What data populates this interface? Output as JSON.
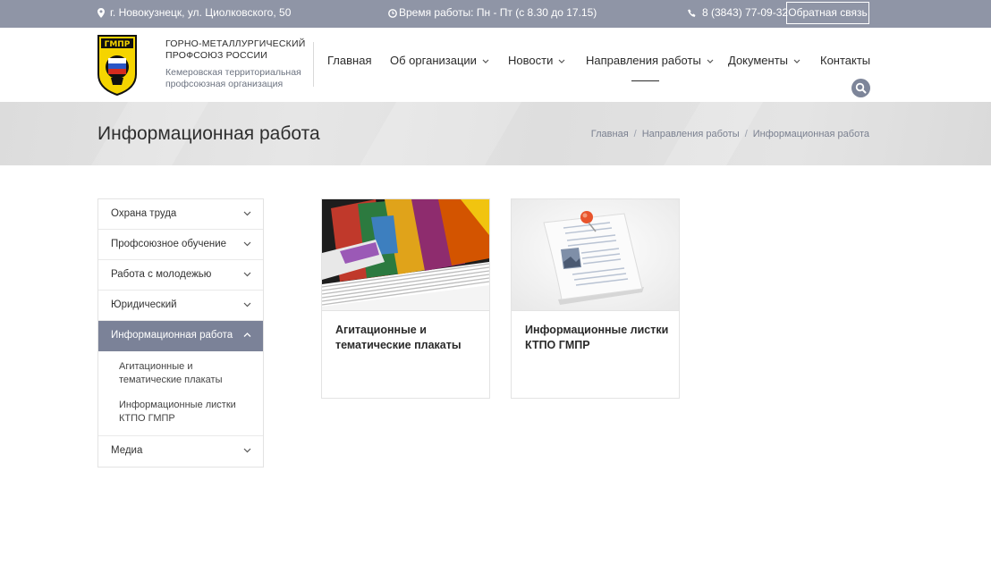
{
  "topbar": {
    "address": "г. Новокузнецк, ул. Циолковского, 50",
    "hours": "Время работы: Пн - Пт (с 8.30 до 17.15)",
    "phone": "8 (3843) 77-09-32",
    "feedback_label": "Обратная связь"
  },
  "brand": {
    "logo_text": "ГМПР",
    "title": "ГОРНО-МЕТАЛЛУРГИЧЕСКИЙ ПРОФСОЮЗ РОССИИ",
    "subtitle": "Кемеровская территориальная профсоюзная организация"
  },
  "nav": {
    "items": [
      {
        "label": "Главная"
      },
      {
        "label": "Об организации"
      },
      {
        "label": "Новости"
      },
      {
        "label": "Направления работы"
      },
      {
        "label": "Документы"
      },
      {
        "label": "Контакты"
      }
    ]
  },
  "page": {
    "title": "Информационная работа",
    "breadcrumb": [
      "Главная",
      "Направления работы",
      "Информационная работа"
    ]
  },
  "sidebar": {
    "items": [
      {
        "label": "Охрана труда"
      },
      {
        "label": "Профсоюзное обучение"
      },
      {
        "label": "Работа с молодежью"
      },
      {
        "label": "Юридический"
      },
      {
        "label": "Информационная работа"
      },
      {
        "label": "Медиа"
      }
    ],
    "submenu": [
      {
        "label": "Агитационные и тематические плакаты"
      },
      {
        "label": "Информационные листки КТПО ГМПР"
      }
    ]
  },
  "cards": [
    {
      "caption": "Агитационные и тематические плакаты"
    },
    {
      "caption": "Информационные листки КТПО ГМПР"
    }
  ],
  "colors": {
    "topbar_bg": "#8f95a6",
    "accent": "#7b8298",
    "logo_yellow": "#f5d400"
  }
}
